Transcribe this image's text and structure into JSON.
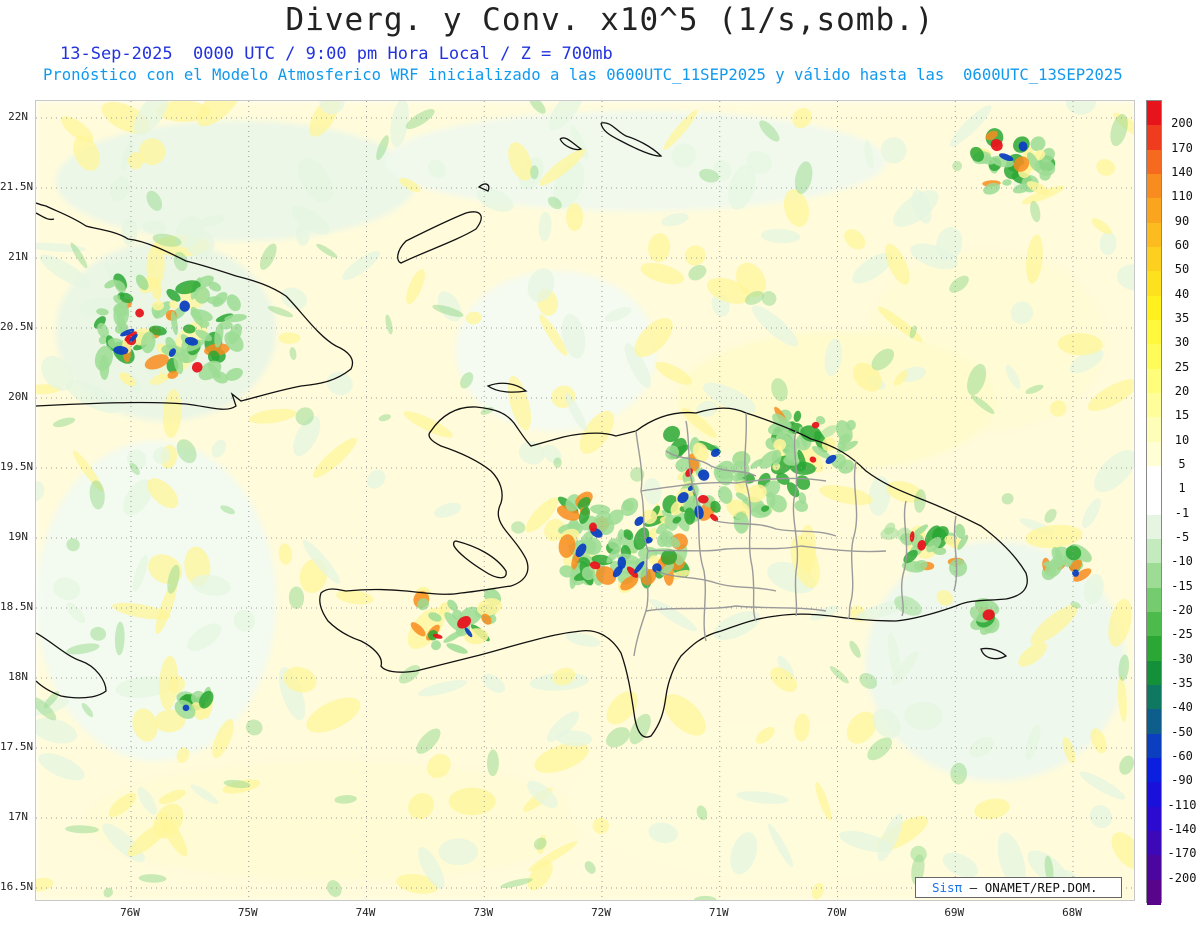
{
  "header": {
    "title": "Diverg. y Conv. x10^5 (1/s,somb.)",
    "subtitle_1": "13-Sep-2025  0000 UTC / 9:00 pm Hora Local / Z = 700mb",
    "subtitle_2": "Pronóstico con el Modelo Atmosferico WRF inicializado a las 0600UTC_11SEP2025 y válido hasta las  0600UTC_13SEP2025"
  },
  "axes": {
    "lat_labels": [
      "22N",
      "21.5N",
      "21N",
      "20.5N",
      "20N",
      "19.5N",
      "19N",
      "18.5N",
      "18N",
      "17.5N",
      "17N",
      "16.5N"
    ],
    "lon_labels": [
      "76W",
      "75W",
      "74W",
      "73W",
      "72W",
      "71W",
      "70W",
      "69W",
      "68W"
    ]
  },
  "colorbar": {
    "labels": [
      "200",
      "170",
      "140",
      "110",
      "90",
      "60",
      "50",
      "40",
      "35",
      "30",
      "25",
      "20",
      "15",
      "10",
      "5",
      "1",
      "-1",
      "-5",
      "-10",
      "-15",
      "-20",
      "-25",
      "-30",
      "-35",
      "-40",
      "-50",
      "-60",
      "-90",
      "-110",
      "-140",
      "-170",
      "-200"
    ],
    "colors": [
      "#e8141c",
      "#f03c1e",
      "#f56a1e",
      "#f88c1e",
      "#fba41e",
      "#fcbb1e",
      "#fdcf1e",
      "#fee11e",
      "#fff01e",
      "#fff83c",
      "#fffc5a",
      "#fffd7a",
      "#fffe9a",
      "#fffeb8",
      "#fffed4",
      "#ffffff",
      "#ffffff",
      "#e6f5e2",
      "#c4ebbe",
      "#9cdc94",
      "#74cc6e",
      "#4dbb4b",
      "#2aa734",
      "#14903a",
      "#0f7860",
      "#0e5e8c",
      "#0c3fc0",
      "#0b1fe0",
      "#1a10dc",
      "#2c0ad0",
      "#3c08b8",
      "#4c06a0",
      "#58058c"
    ]
  },
  "credit": {
    "logo": "Sisπ",
    "text": "– ONAMET/REP.DOM."
  },
  "map": {
    "region": "Hispaniola",
    "field_colors": {
      "light_yellow": "#fffbc8",
      "yellow": "#fff59a",
      "light_green": "#e6f5e2",
      "green": "#9cdc94",
      "dark_green": "#2aa734",
      "blue": "#0c3fc0",
      "orange": "#f88c1e",
      "red": "#e8141c"
    }
  }
}
